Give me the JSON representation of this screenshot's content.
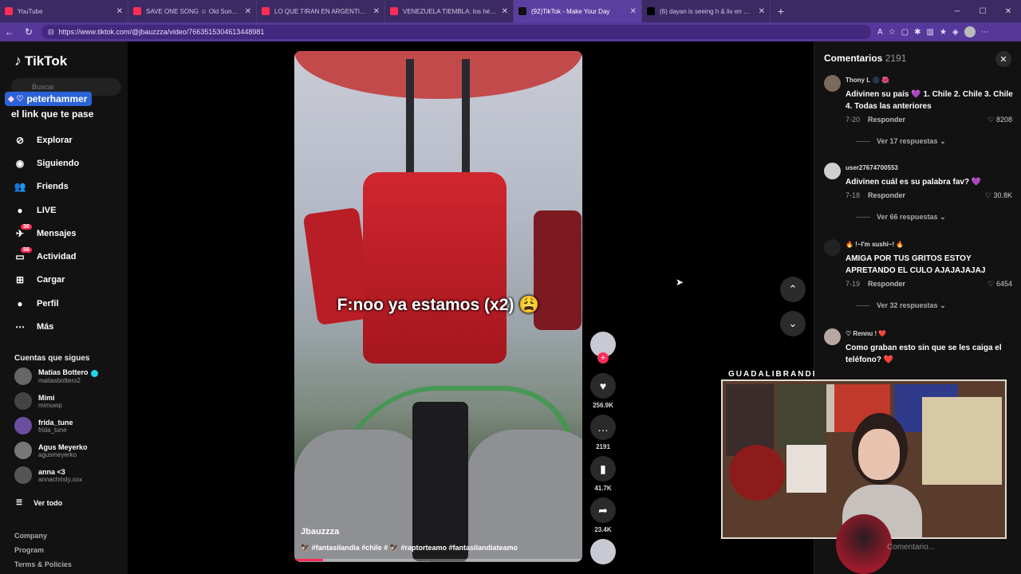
{
  "browser": {
    "tabs": [
      {
        "title": "YouTube",
        "color": "#ff2c55",
        "active": false
      },
      {
        "title": "SAVE ONE SONG ☺ Old Song vs",
        "color": "#ff2c55",
        "active": false
      },
      {
        "title": "LO QUE TIRAN EN ARGENTINA EN",
        "color": "#ff2c55",
        "active": false
      },
      {
        "title": "VENEZUELA TIEMBLA: los héroes c",
        "color": "#ff2c55",
        "active": false
      },
      {
        "title": "(92)TikTok - Make Your Day",
        "color": "#111111",
        "active": true
      },
      {
        "title": "(6) dayan is seeing h & liv en X: \"h",
        "color": "#000000",
        "active": false
      }
    ],
    "url": "https://www.tiktok.com/@jbauzzza/video/7663515304613448981"
  },
  "sidebar": {
    "logo": "TikTok",
    "search_placeholder": "Buscar",
    "overlay_user": "peterhammer",
    "overlay_message": "el link que te pase",
    "nav": [
      {
        "label": "Explorar",
        "icon": "compass-icon",
        "glyph": "⊘"
      },
      {
        "label": "Siguiendo",
        "icon": "following-icon",
        "glyph": "◉"
      },
      {
        "label": "Friends",
        "icon": "friends-icon",
        "glyph": "👥"
      },
      {
        "label": "LIVE",
        "icon": "live-icon",
        "glyph": "●"
      },
      {
        "label": "Mensajes",
        "icon": "messages-icon",
        "glyph": "✈",
        "badge": "36"
      },
      {
        "label": "Actividad",
        "icon": "activity-icon",
        "glyph": "▭",
        "badge": "56"
      },
      {
        "label": "Cargar",
        "icon": "upload-icon",
        "glyph": "⊞"
      },
      {
        "label": "Perfil",
        "icon": "profile-icon",
        "glyph": "●"
      },
      {
        "label": "Más",
        "icon": "more-icon",
        "glyph": "⋯"
      }
    ],
    "following_title": "Cuentas que sigues",
    "accounts": [
      {
        "name": "Matias Bottero",
        "handle": "matiasbottero2",
        "verified": true,
        "color": "#666"
      },
      {
        "name": "Mimi",
        "handle": "mimuwp",
        "verified": false,
        "color": "#444"
      },
      {
        "name": "frida_tune",
        "handle": "frida_tune",
        "verified": false,
        "color": "#6a4fa0"
      },
      {
        "name": "Agus Meyerko",
        "handle": "agusmeyerko",
        "verified": false,
        "color": "#777"
      },
      {
        "name": "anna <3",
        "handle": "annachristy.xox",
        "verified": false,
        "color": "#555"
      }
    ],
    "see_all": "Ver todo",
    "footer": [
      "Company",
      "Program",
      "Terms & Policies"
    ]
  },
  "video": {
    "caption": "F:noo ya estamos (x2) 😩",
    "author": "Jbauzzza",
    "tags": "🦅 #fantasilandia #chile # 🦅 #raptorteamo #fantasilandiateamo",
    "progress": 0.1
  },
  "actions": {
    "likes": "256.9K",
    "comments": "2191",
    "saves": "41.7K",
    "shares": "23.4K"
  },
  "comments_panel": {
    "title": "Comentarios",
    "count": "2191",
    "items": [
      {
        "user": "Thony L 🌑 🌺",
        "text": "Adivinen su país 💜 1. Chile 2. Chile 3. Chile 4. Todas las anteriores",
        "date": "7-20",
        "reply": "Responder",
        "likes": "8208",
        "more": "Ver 17 respuestas",
        "avcolor": "#7a6a5a"
      },
      {
        "user": "user27674700553",
        "text": "Adivinen cuál es su palabra fav? 💜",
        "date": "7-18",
        "reply": "Responder",
        "likes": "30.8K",
        "more": "Ver 66 respuestas",
        "avcolor": "#cfcfcf"
      },
      {
        "user": "🔥 !~I'm sushi~! 🔥",
        "text": "AMIGA POR TUS GRITOS ESTOY APRETANDO EL CULO AJAJAJAJAJ",
        "date": "7-19",
        "reply": "Responder",
        "likes": "6454",
        "more": "Ver 32 respuestas",
        "avcolor": "#222"
      },
      {
        "user": "♡ Rennu ! ❤️",
        "text": "Como graban esto sin que se les caiga el teléfono? ❤️",
        "date": "",
        "reply": "",
        "likes": "",
        "more": "",
        "avcolor": "#b6a8a0"
      }
    ],
    "input_placeholder": "Comentario..."
  },
  "webcam": {
    "label": "GUADALIBRANDI"
  }
}
